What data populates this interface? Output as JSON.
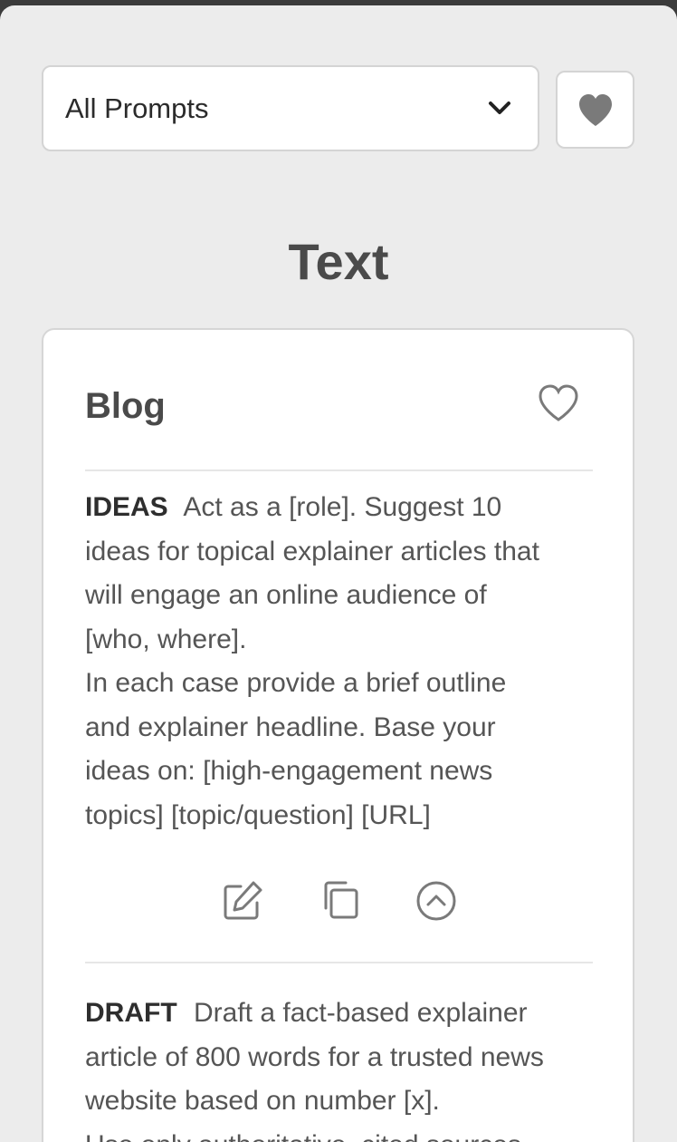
{
  "filter": {
    "selected": "All Prompts",
    "icon": "chevron-down-icon"
  },
  "favorites_filter": {
    "icon": "heart-filled-icon"
  },
  "section": {
    "title": "Text"
  },
  "card": {
    "title": "Blog",
    "favorite_icon": "heart-outline-icon",
    "prompts": [
      {
        "tag": "IDEAS",
        "lines": [
          "Act as a [role]. Suggest 10",
          "ideas for topical explainer articles that",
          "will engage an online audience of",
          "[who, where].",
          "In each case provide a brief outline",
          "and explainer headline. Base your",
          "ideas on: [high-engagement news",
          "topics] [topic/question] [URL]"
        ],
        "actions": [
          "edit-icon",
          "copy-icon",
          "collapse-icon"
        ]
      },
      {
        "tag": "DRAFT",
        "lines": [
          "Draft a fact-based explainer",
          "article of 800 words for a trusted news",
          "website based on number [x].",
          "Use only authoritative, cited sources."
        ]
      }
    ]
  },
  "colors": {
    "background": "#ececec",
    "card": "#ffffff",
    "icon": "#7a7a7a",
    "heading": "#4a4a4a"
  }
}
